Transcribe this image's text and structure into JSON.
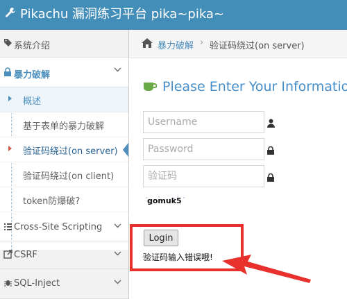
{
  "brand": {
    "title": "Pikachu 漏洞练习平台 pika~pika~"
  },
  "sidebar": {
    "intro": "系统介绍",
    "active_group": "暴力破解",
    "sub_items": [
      {
        "label": "概述"
      },
      {
        "label": "基于表单的暴力破解"
      },
      {
        "label": "验证码绕过(on server)"
      },
      {
        "label": "验证码绕过(on client)"
      },
      {
        "label": "token防爆破?"
      }
    ],
    "groups": [
      {
        "label": "Cross-Site Scripting"
      },
      {
        "label": "CSRF"
      },
      {
        "label": "SQL-Inject"
      }
    ]
  },
  "breadcrumb": {
    "parent": "暴力破解",
    "separator": "›",
    "current": "验证码绕过(on server)"
  },
  "form": {
    "heading": "Please Enter Your Information",
    "username_placeholder": "Username",
    "password_placeholder": "Password",
    "captcha_placeholder": "验证码",
    "captcha_image_text": "gomuk5",
    "login_label": "Login",
    "error_message": "验证码输入错误哦!"
  },
  "colors": {
    "topbar": "#438eb9",
    "accent": "#4c8fbd",
    "highlight": "#e8312c",
    "active_marker": "#d15b47"
  }
}
